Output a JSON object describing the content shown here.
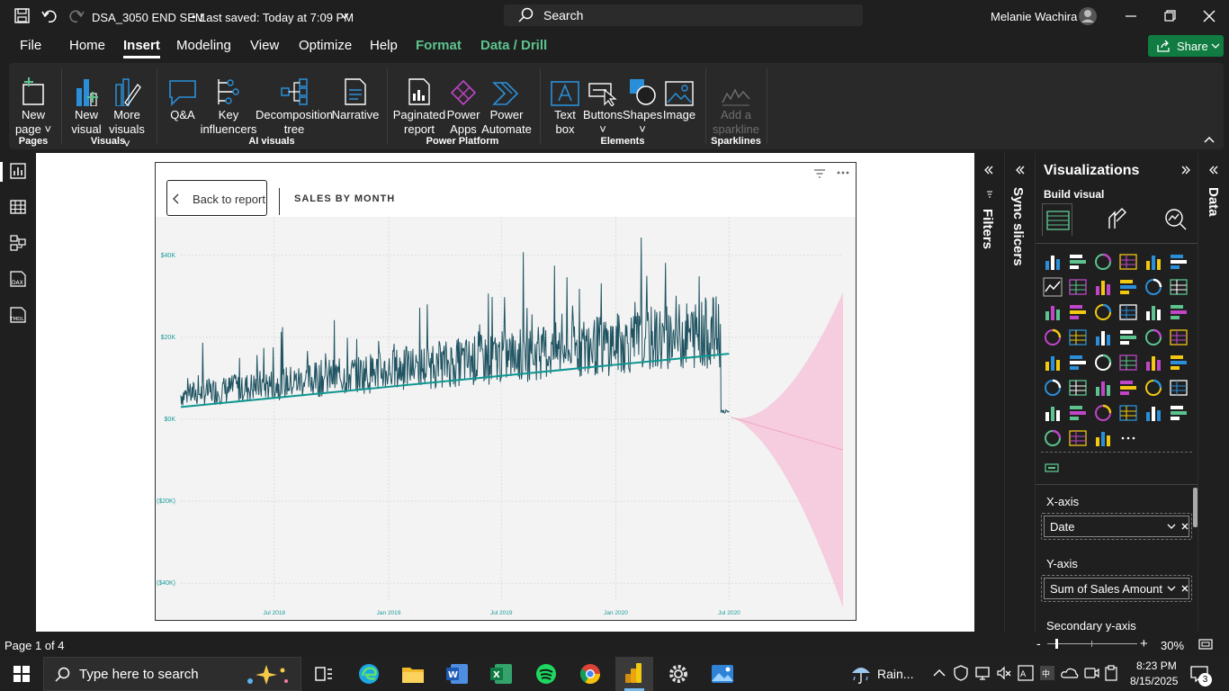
{
  "titlebar": {
    "filename": "DSA_3050 END SEM",
    "saved": "Last saved: Today at 7:09 PM",
    "search_label": "Search",
    "user": "Melanie Wachira"
  },
  "menu": {
    "items": [
      "File",
      "Home",
      "Insert",
      "Modeling",
      "View",
      "Optimize",
      "Help",
      "Format",
      "Data / Drill"
    ],
    "share": "Share"
  },
  "ribbon": {
    "buttons": [
      {
        "l1": "New",
        "l2": "page ˅"
      },
      {
        "l1": "New",
        "l2": "visual"
      },
      {
        "l1": "More",
        "l2": "visuals ˅"
      },
      {
        "l1": "Q&A",
        "l2": ""
      },
      {
        "l1": "Key",
        "l2": "influencers"
      },
      {
        "l1": "Decomposition",
        "l2": "tree"
      },
      {
        "l1": "Narrative",
        "l2": ""
      },
      {
        "l1": "Paginated",
        "l2": "report"
      },
      {
        "l1": "Power",
        "l2": "Apps"
      },
      {
        "l1": "Power",
        "l2": "Automate"
      },
      {
        "l1": "Text",
        "l2": "box"
      },
      {
        "l1": "Buttons",
        "l2": "˅"
      },
      {
        "l1": "Shapes",
        "l2": "˅"
      },
      {
        "l1": "Image",
        "l2": ""
      },
      {
        "l1": "Add a",
        "l2": "sparkline"
      }
    ],
    "groups": [
      "Pages",
      "Visuals",
      "AI visuals",
      "Power Platform",
      "Elements",
      "Sparklines"
    ]
  },
  "report": {
    "back_label": "Back to report",
    "visual_title": "SALES BY MONTH"
  },
  "chart_data": {
    "type": "line",
    "title": "SALES BY MONTH",
    "ytick_labels": [
      "$40K",
      "$20K",
      "$0K",
      "($20K)",
      "($40K)"
    ],
    "xtick_labels": [
      "Jul 2018",
      "Jan 2019",
      "Jul 2019",
      "Jan 2020",
      "Jul 2020"
    ],
    "ylim": [
      -45000,
      45000
    ],
    "x_range": [
      "2018-02-01",
      "2020-12-31"
    ],
    "grid": true,
    "series_color": "#1f5361",
    "trend_color": "#0f9690",
    "forecast_color": "#f5c6d9",
    "trend": {
      "start": 3000,
      "end": 16000
    },
    "forecast": {
      "center_end": -7500,
      "upper_end": 31000,
      "lower_end": -46000
    }
  },
  "panes": {
    "filters_label": "Filters",
    "sync_label": "Sync slicers",
    "viz_title": "Visualizations",
    "build_label": "Build visual",
    "data_label": "Data",
    "xaxis_label": "X-axis",
    "xaxis_field": "Date",
    "yaxis_label": "Y-axis",
    "yaxis_field": "Sum of Sales Amount",
    "secondary_label": "Secondary y-axis"
  },
  "status": {
    "page": "Page 1 of 4",
    "zoom": "30%"
  },
  "taskbar": {
    "search_placeholder": "Type here to search",
    "weather": "Rain...",
    "time": "8:23 PM",
    "date": "8/15/2025",
    "notif_count": "3"
  }
}
